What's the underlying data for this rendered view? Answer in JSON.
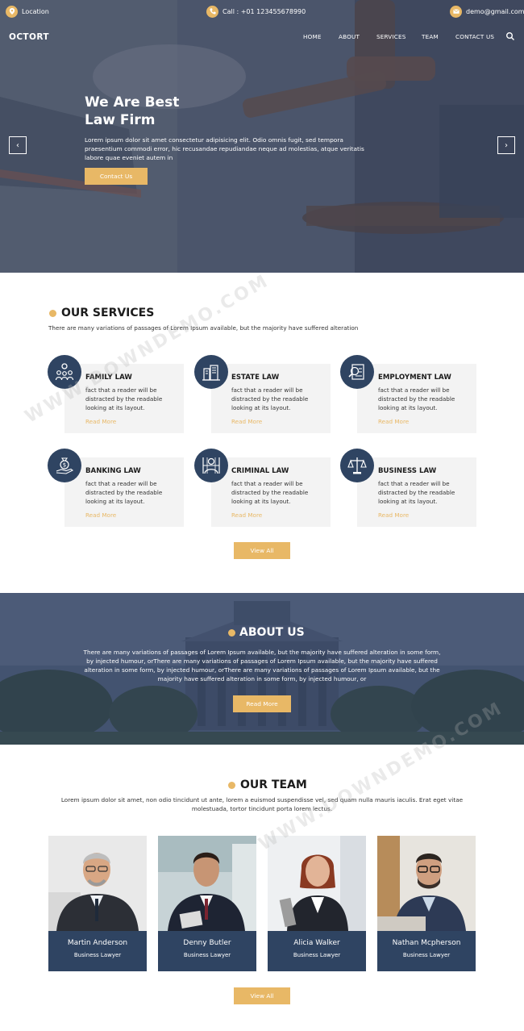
{
  "topbar": {
    "location": "Location",
    "phone": "Call : +01 123455678990",
    "email": "demo@gmail.com"
  },
  "nav": {
    "logo": "OCTORT",
    "items": [
      "HOME",
      "ABOUT",
      "SERVICES",
      "TEAM",
      "CONTACT US"
    ]
  },
  "hero": {
    "title_line1": "We Are Best",
    "title_line2": "Law Firm",
    "text": "Lorem ipsum dolor sit amet consectetur adipisicing elit. Odio omnis fugit, sed tempora praesentium commodi error, hic recusandae repudiandae neque ad molestias, atque veritatis labore quae eveniet autem in",
    "button": "Contact Us",
    "prev": "‹",
    "next": "›"
  },
  "services": {
    "title": "OUR SERVICES",
    "subtitle": "There are many variations of passages of Lorem Ipsum available, but the majority have suffered alteration",
    "cards": [
      {
        "title": "FAMILY LAW",
        "text": "fact that a reader will be distracted by the readable looking at its layout.",
        "link": "Read More",
        "icon": "family-icon"
      },
      {
        "title": "ESTATE LAW",
        "text": "fact that a reader will be distracted by the readable looking at its layout.",
        "link": "Read More",
        "icon": "estate-icon"
      },
      {
        "title": "EMPLOYMENT LAW",
        "text": "fact that a reader will be distracted by the readable looking at its layout.",
        "link": "Read More",
        "icon": "employment-icon"
      },
      {
        "title": "BANKING LAW",
        "text": "fact that a reader will be distracted by the readable looking at its layout.",
        "link": "Read More",
        "icon": "banking-icon"
      },
      {
        "title": "CRIMINAL LAW",
        "text": "fact that a reader will be distracted by the readable looking at its layout.",
        "link": "Read More",
        "icon": "criminal-icon"
      },
      {
        "title": "BUSINESS LAW",
        "text": "fact that a reader will be distracted by the readable looking at its layout.",
        "link": "Read More",
        "icon": "business-icon"
      }
    ],
    "button": "View All"
  },
  "about": {
    "title": "ABOUT US",
    "text": "There are many variations of passages of Lorem Ipsum available, but the majority have suffered alteration in some form, by injected humour, orThere are many variations of passages of Lorem Ipsum available, but the majority have suffered alteration in some form, by injected humour, orThere are many variations of passages of Lorem Ipsum available, but the majority have suffered alteration in some form, by injected humour, or",
    "button": "Read More"
  },
  "team": {
    "title": "OUR TEAM",
    "subtitle": "Lorem ipsum dolor sit amet, non odio tincidunt ut ante, lorem a euismod suspendisse vel, sed quam nulla mauris iaculis. Erat eget vitae molestuada, tortor tincidunt porta lorem lectus.",
    "members": [
      {
        "name": "Martin Anderson",
        "role": "Business Lawyer"
      },
      {
        "name": "Denny Butler",
        "role": "Business Lawyer"
      },
      {
        "name": "Alicia Walker",
        "role": "Business Lawyer"
      },
      {
        "name": "Nathan Mcpherson",
        "role": "Business Lawyer"
      }
    ],
    "button": "View All"
  },
  "watermark": "WWW.DOWNDEMO.COM",
  "colors": {
    "accent": "#e8b866",
    "navy": "#2f4462",
    "card": "#f3f3f3"
  }
}
